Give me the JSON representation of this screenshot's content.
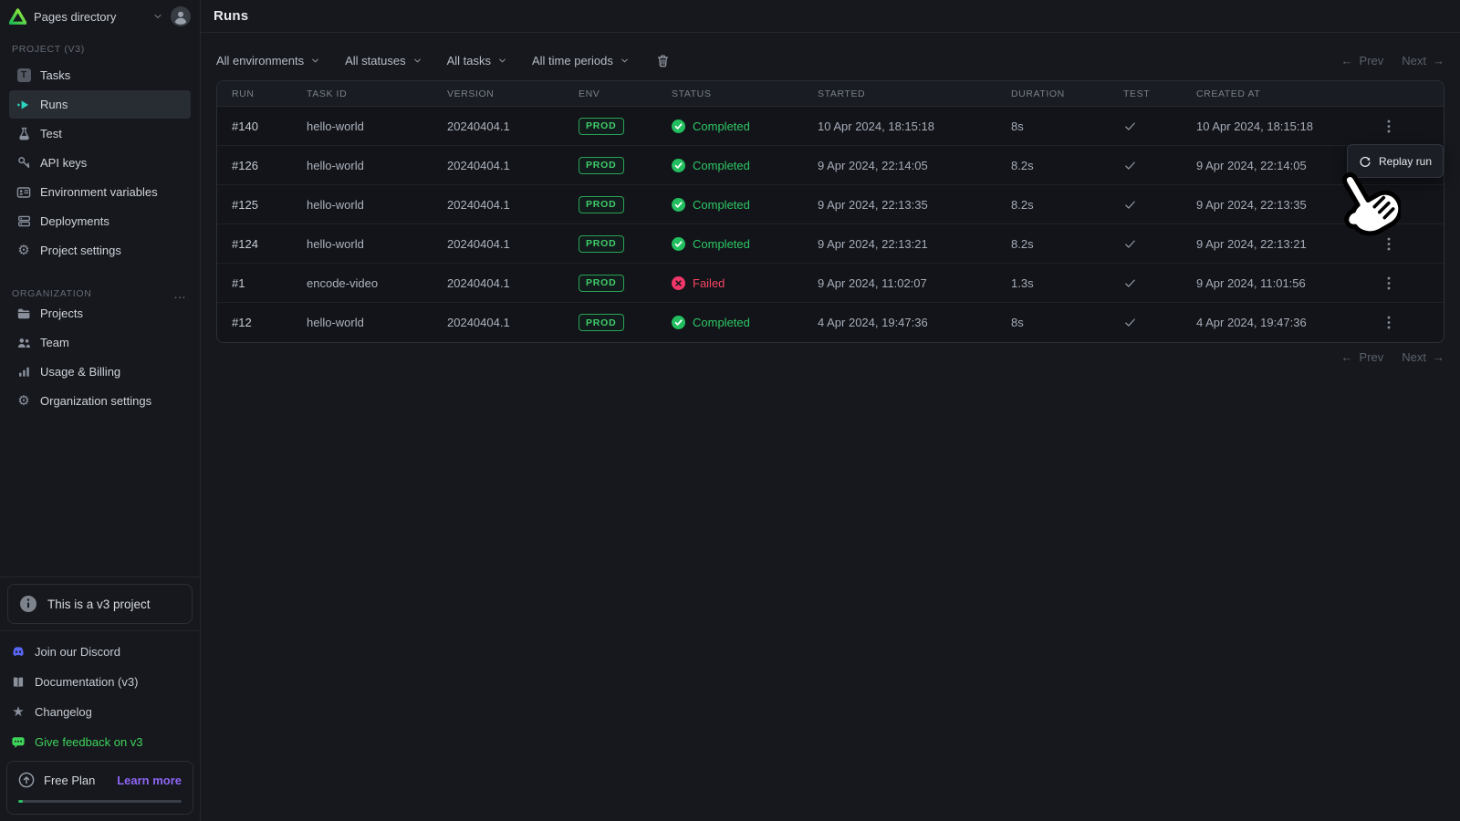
{
  "sidebar": {
    "workspace": "Pages directory",
    "project_section": {
      "label": "PROJECT (V3)",
      "items": [
        {
          "label": "Tasks",
          "icon": "tasks-icon"
        },
        {
          "label": "Runs",
          "icon": "runs-icon",
          "active": true
        },
        {
          "label": "Test",
          "icon": "flask-icon"
        },
        {
          "label": "API keys",
          "icon": "key-icon"
        },
        {
          "label": "Environment variables",
          "icon": "id-card-icon"
        },
        {
          "label": "Deployments",
          "icon": "server-stack-icon"
        },
        {
          "label": "Project settings",
          "icon": "gear-icon"
        }
      ]
    },
    "org_section": {
      "label": "ORGANIZATION",
      "items": [
        {
          "label": "Projects",
          "icon": "folder-icon"
        },
        {
          "label": "Team",
          "icon": "team-icon"
        },
        {
          "label": "Usage & Billing",
          "icon": "bar-chart-icon"
        },
        {
          "label": "Organization settings",
          "icon": "gear-icon"
        }
      ]
    },
    "notice": "This is a v3 project",
    "links": [
      {
        "label": "Join our Discord",
        "icon": "discord-icon"
      },
      {
        "label": "Documentation (v3)",
        "icon": "book-icon"
      },
      {
        "label": "Changelog",
        "icon": "star-icon"
      },
      {
        "label": "Give feedback on v3",
        "icon": "feedback-bubble-icon"
      }
    ],
    "plan": {
      "name": "Free Plan",
      "action": "Learn more",
      "progress_percent": 3
    }
  },
  "main": {
    "title": "Runs",
    "filters": [
      {
        "label": "All environments"
      },
      {
        "label": "All statuses"
      },
      {
        "label": "All tasks"
      },
      {
        "label": "All time periods"
      }
    ],
    "pagination": {
      "prev": "Prev",
      "next": "Next"
    },
    "table": {
      "columns": [
        "RUN",
        "TASK ID",
        "VERSION",
        "ENV",
        "STATUS",
        "STARTED",
        "DURATION",
        "TEST",
        "CREATED AT"
      ],
      "rows": [
        {
          "run": "#140",
          "task_id": "hello-world",
          "version": "20240404.1",
          "env": "PROD",
          "status": "Completed",
          "status_type": "completed",
          "started": "10 Apr 2024, 18:15:18",
          "duration": "8s",
          "test": true,
          "created_at": "10 Apr 2024, 18:15:18"
        },
        {
          "run": "#126",
          "task_id": "hello-world",
          "version": "20240404.1",
          "env": "PROD",
          "status": "Completed",
          "status_type": "completed",
          "started": "9 Apr 2024, 22:14:05",
          "duration": "8.2s",
          "test": true,
          "created_at": "9 Apr 2024, 22:14:05"
        },
        {
          "run": "#125",
          "task_id": "hello-world",
          "version": "20240404.1",
          "env": "PROD",
          "status": "Completed",
          "status_type": "completed",
          "started": "9 Apr 2024, 22:13:35",
          "duration": "8.2s",
          "test": true,
          "created_at": "9 Apr 2024, 22:13:35"
        },
        {
          "run": "#124",
          "task_id": "hello-world",
          "version": "20240404.1",
          "env": "PROD",
          "status": "Completed",
          "status_type": "completed",
          "started": "9 Apr 2024, 22:13:21",
          "duration": "8.2s",
          "test": true,
          "created_at": "9 Apr 2024, 22:13:21"
        },
        {
          "run": "#1",
          "task_id": "encode-video",
          "version": "20240404.1",
          "env": "PROD",
          "status": "Failed",
          "status_type": "failed",
          "started": "9 Apr 2024, 11:02:07",
          "duration": "1.3s",
          "test": true,
          "created_at": "9 Apr 2024, 11:01:56"
        },
        {
          "run": "#12",
          "task_id": "hello-world",
          "version": "20240404.1",
          "env": "PROD",
          "status": "Completed",
          "status_type": "completed",
          "started": "4 Apr 2024, 19:47:36",
          "duration": "8s",
          "test": true,
          "created_at": "4 Apr 2024, 19:47:36"
        }
      ]
    },
    "popover": {
      "label": "Replay run",
      "icon": "replay-icon"
    }
  },
  "icons": {
    "tasks_letter": "T",
    "gear": "⚙",
    "star": "★",
    "dots_horizontal": "…",
    "arrow_left": "←",
    "arrow_right": "→"
  },
  "colors": {
    "green": "#2FC765",
    "red": "#F64562",
    "teal": "#2DD4BF",
    "purple": "#8F66F6",
    "discord_blue": "#5865F2",
    "feedback_green": "#3ED45A"
  }
}
